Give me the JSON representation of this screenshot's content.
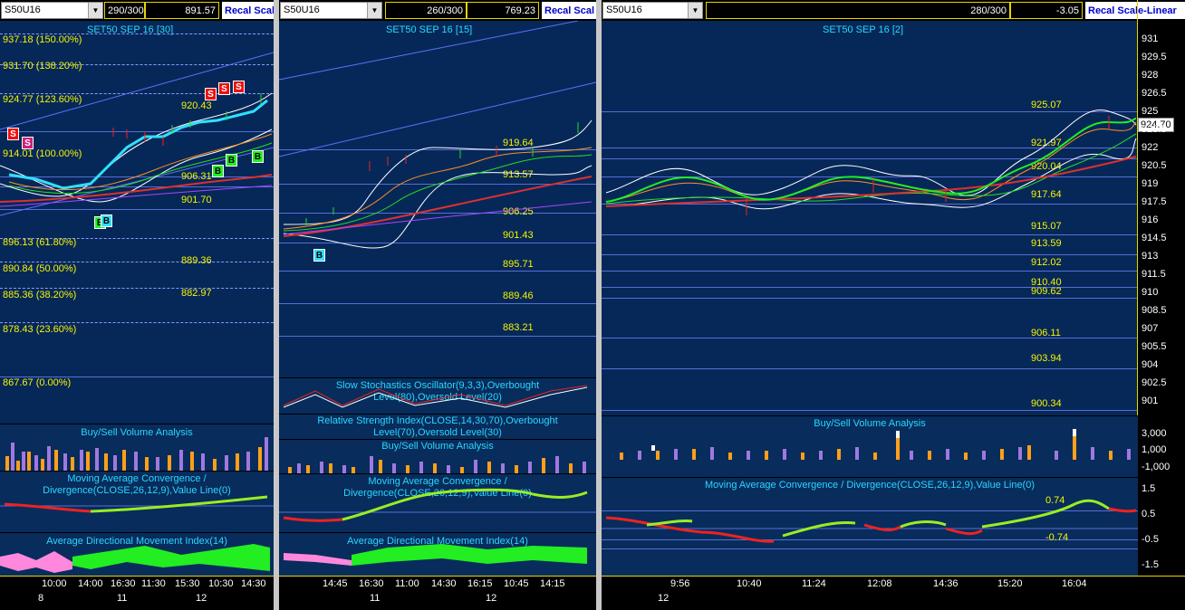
{
  "panel1": {
    "symbol": "S50U16",
    "bars": "290/300",
    "price": "891.57",
    "recal": "Recal Scal",
    "title": "SET50 SEP 16  [30]",
    "fib_labels": [
      "937.18 (150.00%)",
      "931.70 (138.20%)",
      "924.77 (123.60%)",
      "914.01 (100.00%)",
      "896.13 (61.80%)",
      "890.84 (50.00%)",
      "885.36 (38.20%)",
      "878.43 (23.60%)",
      "867.67 (0.00%)"
    ],
    "level_labels": [
      "920.43",
      "906.31",
      "901.70",
      "889.36",
      "882.97"
    ],
    "buy_sell_title": "Buy/Sell Volume Analysis",
    "macd_title": "Moving Average Convergence / Divergence(CLOSE,26,12,9),Value Line(0)",
    "adx_title": "Average Directional Movement Index(14)",
    "times": [
      "10:00",
      "14:00",
      "16:30",
      "11:30",
      "15:30",
      "10:30",
      "14:30"
    ],
    "dates": [
      "8",
      "11",
      "12"
    ]
  },
  "panel2": {
    "symbol": "S50U16",
    "bars": "260/300",
    "price": "769.23",
    "recal": "Recal Scal",
    "title": "SET50 SEP 16  [15]",
    "level_labels": [
      "919.64",
      "913.57",
      "906.25",
      "901.43",
      "895.71",
      "889.46",
      "883.21"
    ],
    "stoch_title": "Slow Stochastics Oscillator(9,3,3),Overbought Level(80),Oversold Level(20)",
    "rsi_title": "Relative Strength Index(CLOSE,14,30,70),Overbought Level(70),Oversold Level(30)",
    "buy_sell_title": "Buy/Sell Volume Analysis",
    "macd_title": "Moving Average Convergence / Divergence(CLOSE,26,12,9),Value Line(0)",
    "adx_title": "Average Directional Movement Index(14)",
    "times": [
      "14:45",
      "16:30",
      "11:00",
      "14:30",
      "16:15",
      "10:45",
      "14:15"
    ],
    "dates": [
      "11",
      "12"
    ]
  },
  "panel3": {
    "symbol": "S50U16",
    "bars": "280/300",
    "price": "-3.05",
    "recal": "Recal Scale-Linear",
    "title": "SET50 SEP 16  [2]",
    "level_labels": [
      "925.07",
      "921.97",
      "920.04",
      "917.64",
      "915.07",
      "913.59",
      "912.02",
      "910.40",
      "909.62",
      "906.11",
      "903.94",
      "900.34"
    ],
    "last_price": "924.70",
    "y_ticks": [
      "931",
      "929.5",
      "928",
      "926.5",
      "925",
      "923.5",
      "922",
      "920.5",
      "919",
      "917.5",
      "916",
      "914.5",
      "913",
      "911.5",
      "910",
      "908.5",
      "907",
      "905.5",
      "904",
      "902.5",
      "901"
    ],
    "vol_ticks": [
      "3,000",
      "1,000",
      "-1,000"
    ],
    "macd_ticks": [
      "1.5",
      "0.5",
      "-0.5",
      "-1.5"
    ],
    "macd_levels": [
      "0.74",
      "-0.74"
    ],
    "buy_sell_title": "Buy/Sell Volume Analysis",
    "macd_title": "Moving Average Convergence / Divergence(CLOSE,26,12,9),Value Line(0)",
    "times": [
      "9:56",
      "10:40",
      "11:24",
      "12:08",
      "14:36",
      "15:20",
      "16:04"
    ],
    "dates": [
      "12"
    ]
  },
  "signals": {
    "buy": "B",
    "sell": "S"
  },
  "colors": {
    "bg": "#062858",
    "accent": "#e8d400",
    "label": "#28d8ff",
    "levels": "#f5f500",
    "green": "#22dd22",
    "red": "#ee2222"
  }
}
